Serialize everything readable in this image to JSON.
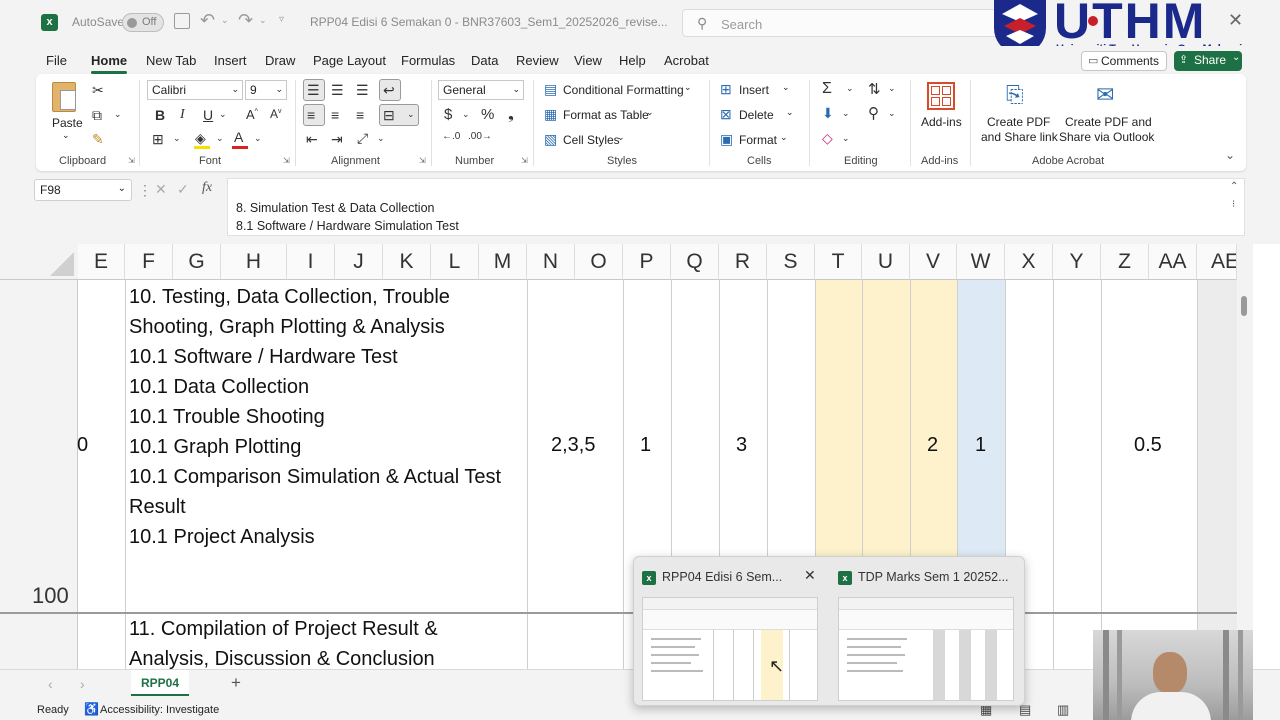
{
  "titlebar": {
    "autosave_label": "AutoSave",
    "autosave_state": "Off",
    "doc_title": "RPP04 Edisi 6 Semakan 0 - BNR37603_Sem1_20252026_revise...",
    "search_placeholder": "Search",
    "logo_text": "UTHM",
    "logo_subtext": "Universiti Tun Hussein Onn Malaysia"
  },
  "menu": {
    "items": [
      "File",
      "Home",
      "New Tab",
      "Insert",
      "Draw",
      "Page Layout",
      "Formulas",
      "Data",
      "Review",
      "View",
      "Help",
      "Acrobat"
    ],
    "active": "Home",
    "comments_label": "Comments",
    "share_label": "Share"
  },
  "ribbon": {
    "clipboard": {
      "paste": "Paste",
      "label": "Clipboard"
    },
    "font": {
      "family": "Calibri",
      "size": "9",
      "label": "Font",
      "bold": "B",
      "italic": "I",
      "underline": "U"
    },
    "alignment": {
      "label": "Alignment"
    },
    "number": {
      "format": "General",
      "label": "Number",
      "currency": "$",
      "percent": "%"
    },
    "styles": {
      "conditional": "Conditional Formatting",
      "format_table": "Format as Table",
      "cell_styles": "Cell Styles",
      "label": "Styles"
    },
    "cells": {
      "insert": "Insert",
      "delete": "Delete",
      "format": "Format",
      "label": "Cells"
    },
    "editing": {
      "label": "Editing"
    },
    "addins": {
      "button": "Add-ins",
      "label": "Add-ins"
    },
    "acrobat": {
      "create_pdf_l1": "Create PDF",
      "create_pdf_l2": "and Share link",
      "create_outlook_l1": "Create PDF and",
      "create_outlook_l2": "Share via Outlook",
      "label": "Adobe Acrobat"
    }
  },
  "formula": {
    "namebox": "F98",
    "fx": "fx",
    "line1": "8. Simulation Test & Data Collection",
    "line2": "8.1 Software / Hardware Simulation Test"
  },
  "grid": {
    "columns": [
      "E",
      "F",
      "G",
      "H",
      "I",
      "J",
      "K",
      "L",
      "M",
      "N",
      "O",
      "P",
      "Q",
      "R",
      "S",
      "T",
      "U",
      "V",
      "W",
      "X",
      "Y",
      "Z",
      "AA",
      "AE"
    ],
    "row_number": "100",
    "row_fragment": "0",
    "cell_main_lines": [
      "10. Testing, Data Collection, Trouble",
      "Shooting, Graph Plotting & Analysis",
      "10.1 Software / Hardware Test",
      "10.1 Data Collection",
      "10.1 Trouble Shooting",
      "10.1 Graph Plotting",
      "10.1 Comparison Simulation & Actual Test",
      "Result",
      "10.1 Project Analysis"
    ],
    "cell_values": {
      "N": "2,3,5",
      "P": "1",
      "R": "3",
      "V": "2",
      "W": "1",
      "Z": "0.5"
    },
    "next_row_lines": [
      "11. Compilation of Project Result &",
      "Analysis,  Discussion & Conclusion"
    ]
  },
  "sheets": {
    "active": "RPP04",
    "add": "+"
  },
  "status": {
    "ready": "Ready",
    "accessibility": "Accessibility: Investigate"
  },
  "preview": {
    "card1_title": "RPP04 Edisi 6 Sem...",
    "card2_title": "TDP Marks Sem 1 20252..."
  },
  "colors": {
    "excel_green": "#1e7145",
    "yellow_col": "#fdf2cc",
    "blue_col": "#dde9f4"
  }
}
